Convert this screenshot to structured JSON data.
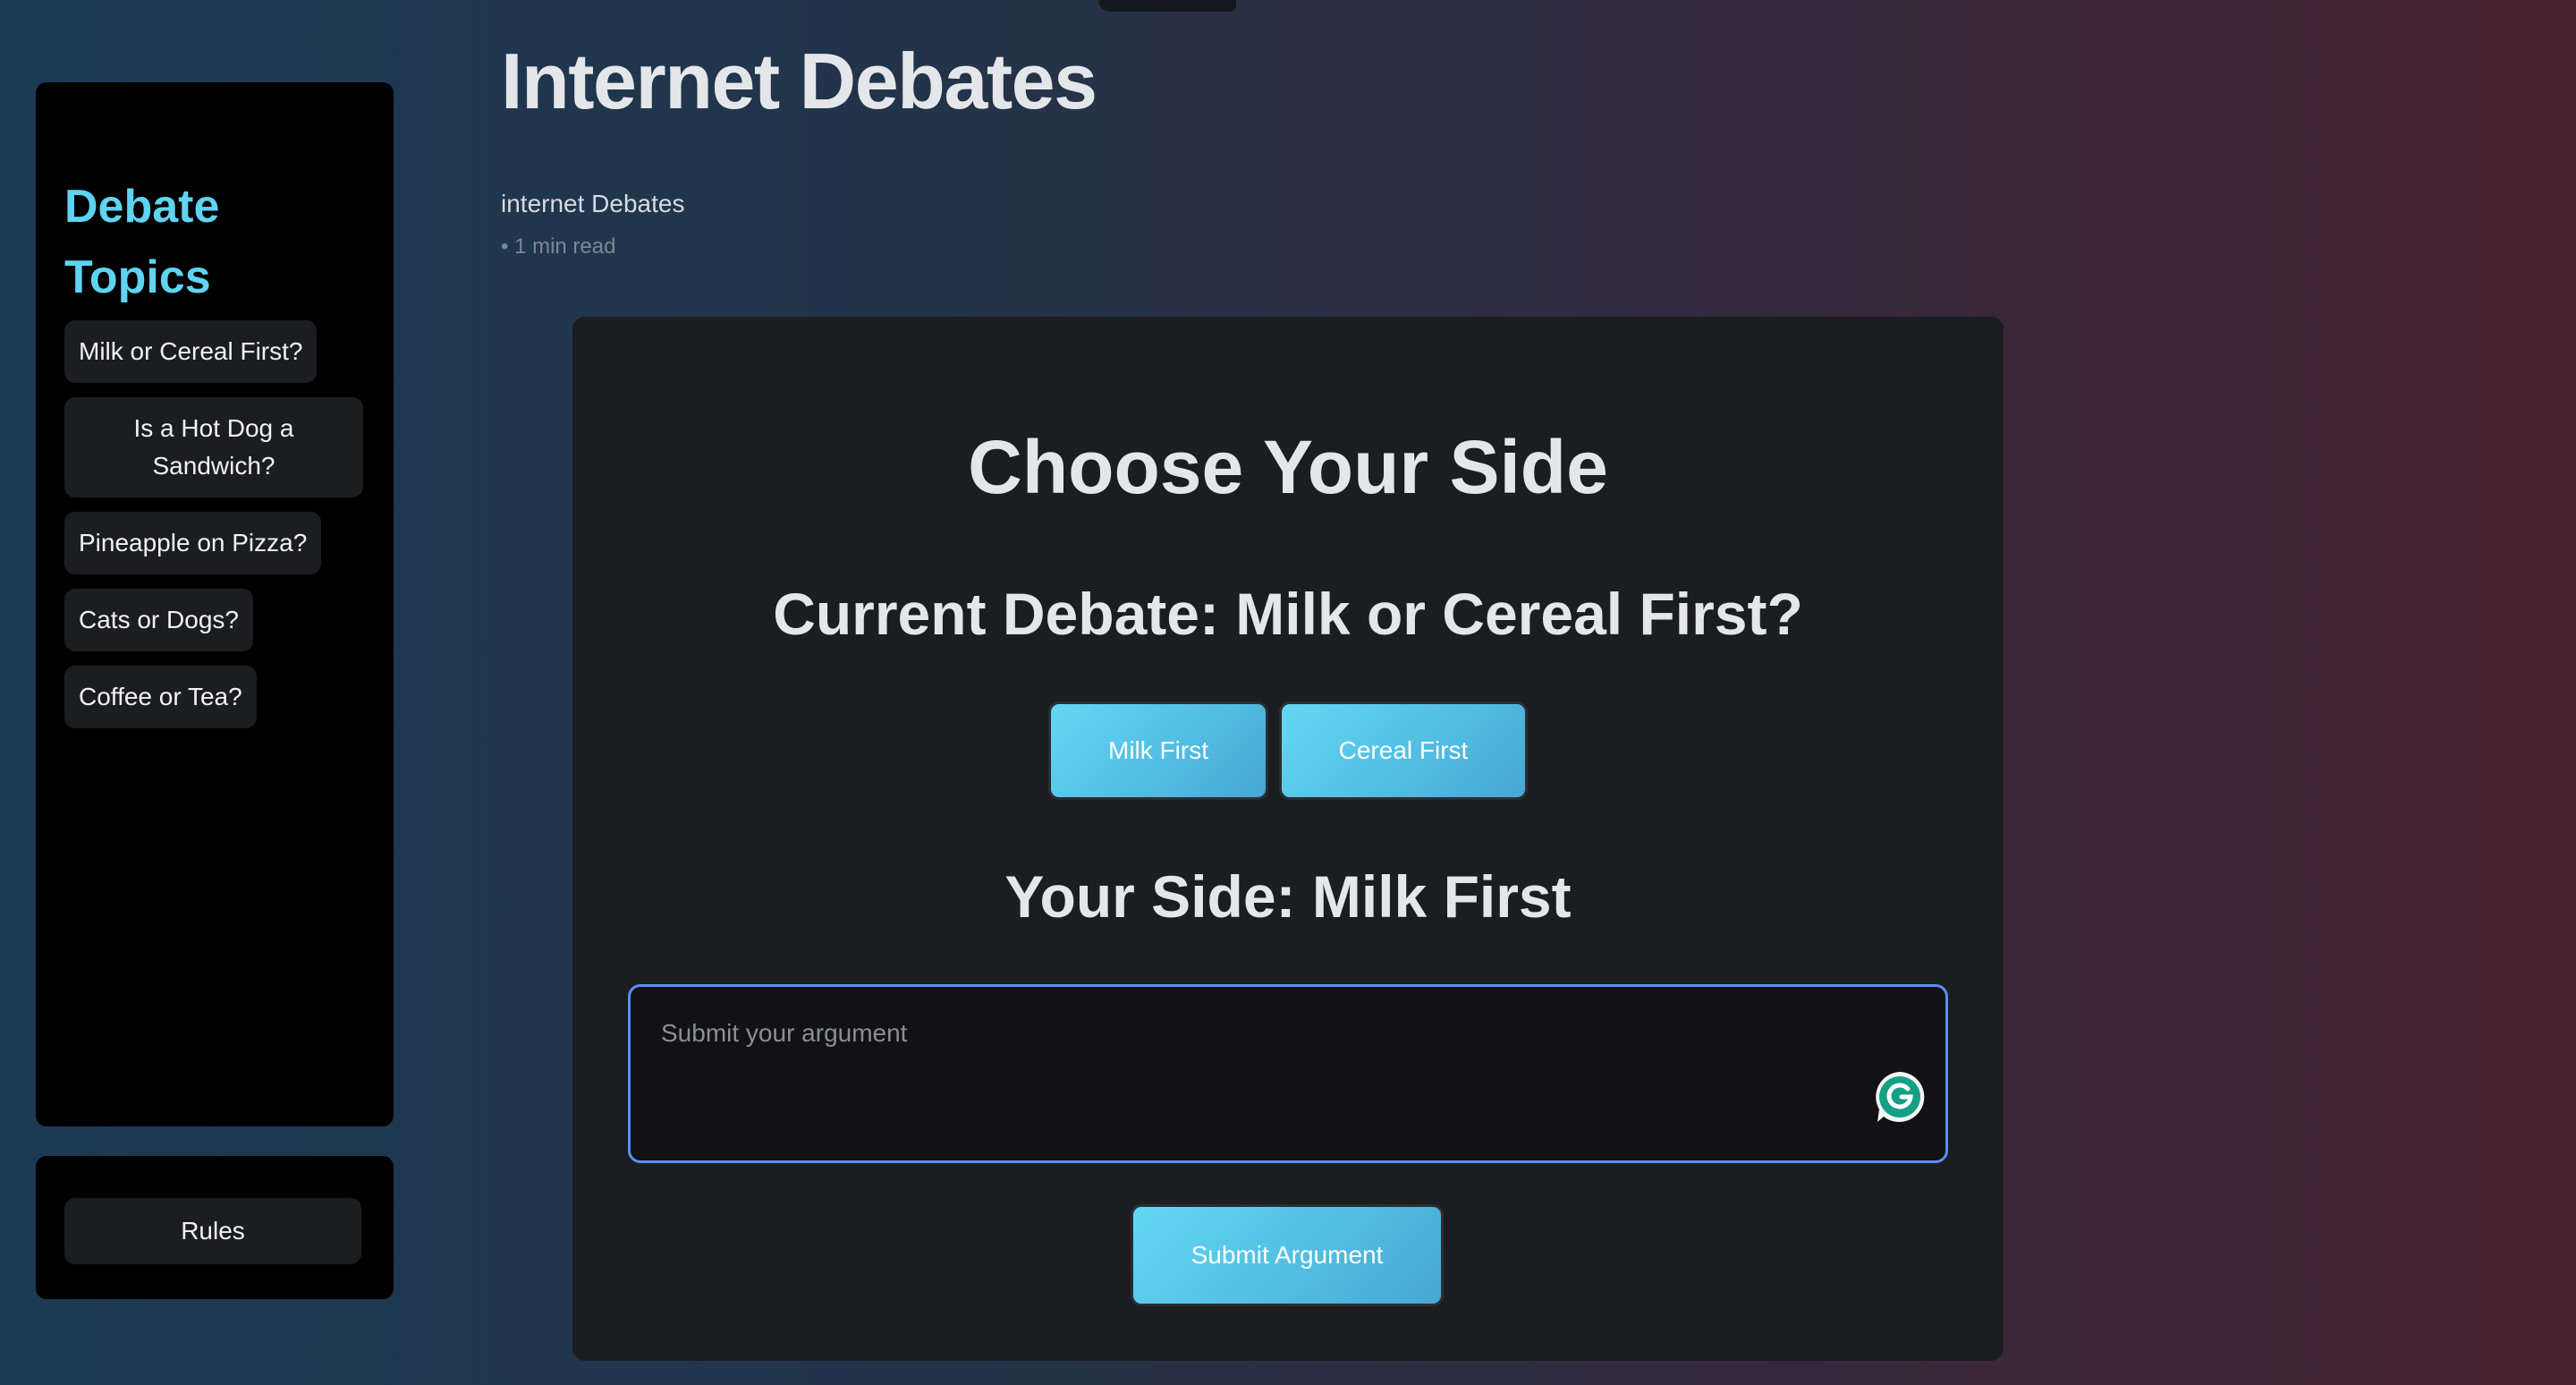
{
  "header": {
    "title": "Internet Debates",
    "byline": "internet Debates",
    "meta": "• 1 min read"
  },
  "sidebar": {
    "title": "Debate Topics",
    "items": [
      {
        "label": "Milk or Cereal First?"
      },
      {
        "label": "Is a Hot Dog a Sandwich?"
      },
      {
        "label": "Pineapple on Pizza?"
      },
      {
        "label": "Cats or Dogs?"
      },
      {
        "label": "Coffee or Tea?"
      }
    ],
    "rules_label": "Rules"
  },
  "main": {
    "heading": "Choose Your Side",
    "current_debate": "Current Debate: Milk or Cereal First?",
    "options": [
      {
        "label": "Milk First"
      },
      {
        "label": "Cereal First"
      }
    ],
    "your_side": "Your Side: Milk First",
    "argument": {
      "value": "",
      "placeholder": "Submit your argument"
    },
    "submit_label": "Submit Argument"
  },
  "colors": {
    "accent": "#5fd3f0",
    "button_gradient_start": "#62d8f4",
    "button_gradient_end": "#46a8d4",
    "focus_border": "#5a8ff0",
    "assist_icon": "#15a085"
  },
  "icons": {
    "writing_assistant": "grammarly-g-icon"
  }
}
